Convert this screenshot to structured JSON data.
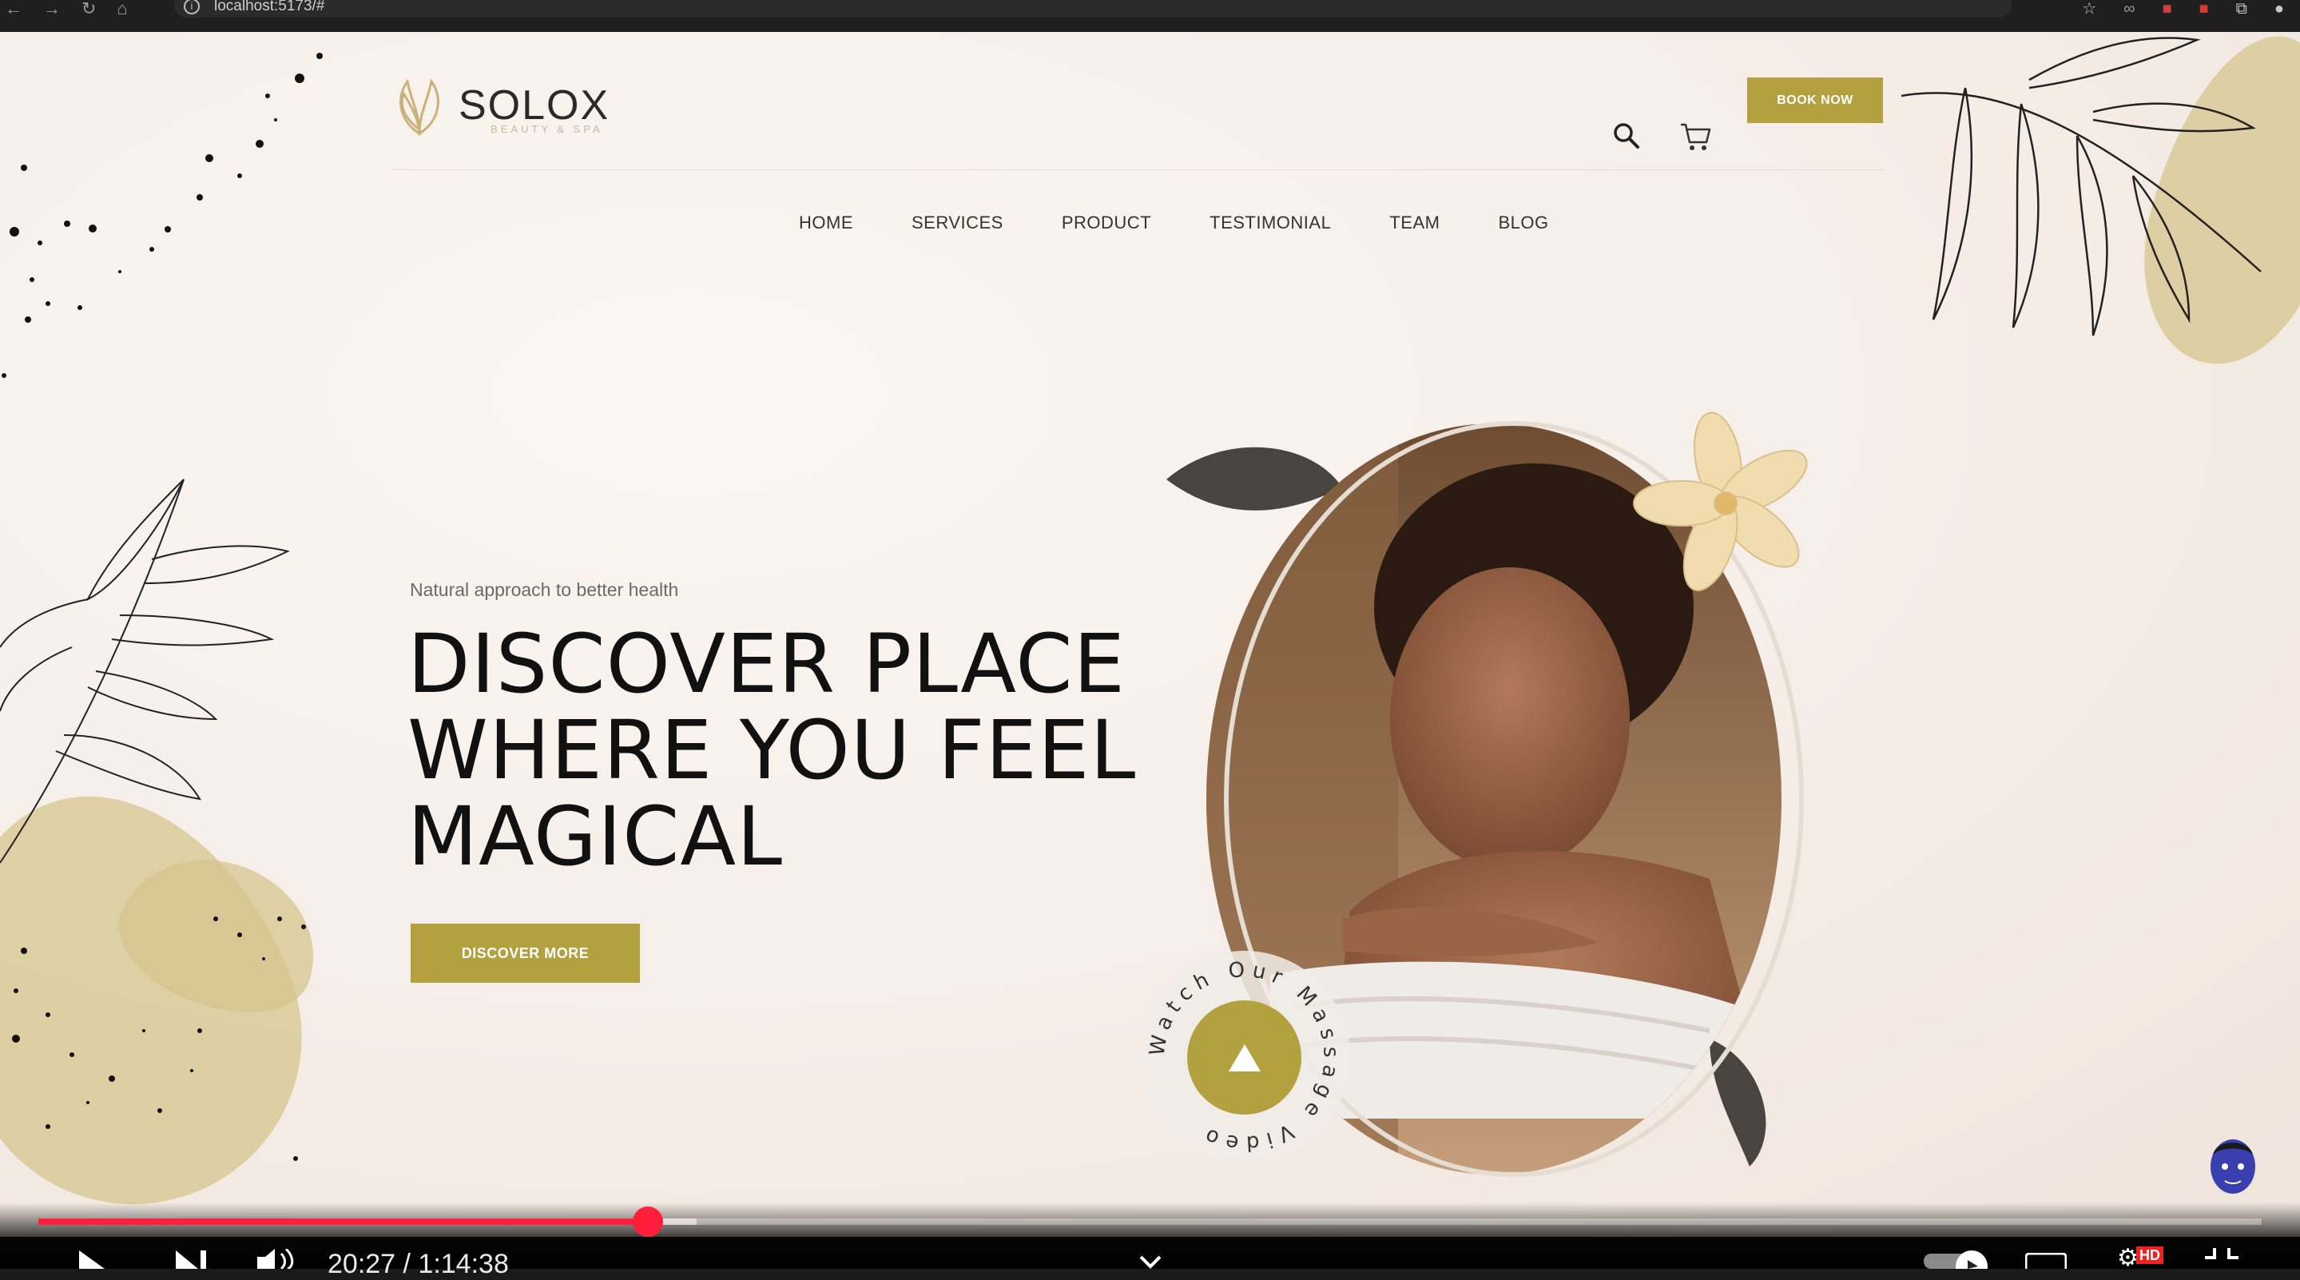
{
  "browser": {
    "url": "localhost:5173/#",
    "nav_icons": [
      "back-arrow-icon",
      "forward-arrow-icon",
      "reload-icon",
      "home-icon"
    ],
    "extension_icons": [
      "star-icon",
      "extension-icon",
      "extension-icon",
      "extension-icon",
      "puzzle-icon",
      "profile-icon"
    ]
  },
  "site": {
    "logo": {
      "name": "SOLOX",
      "subtitle": "BEAUTY & SPA"
    },
    "book_now": "BOOK NOW",
    "nav": [
      "HOME",
      "SERVICES",
      "PRODUCT",
      "TESTIMONIAL",
      "TEAM",
      "BLOG"
    ]
  },
  "hero": {
    "tagline": "Natural approach to better health",
    "headline_lines": [
      "DISCOVER PLACE",
      "WHERE YOU FEEL",
      "MAGICAL"
    ],
    "cta": "DISCOVER MORE",
    "watch_video": "Watch Our Massage Video"
  },
  "player": {
    "time_display": "20:27 / 1:14:38",
    "progress_fraction": 0.274,
    "buffered_fraction": 0.296,
    "hd_badge": "HD"
  },
  "colors": {
    "accent": "#b3a03f",
    "progress": "#ff1f3a"
  }
}
